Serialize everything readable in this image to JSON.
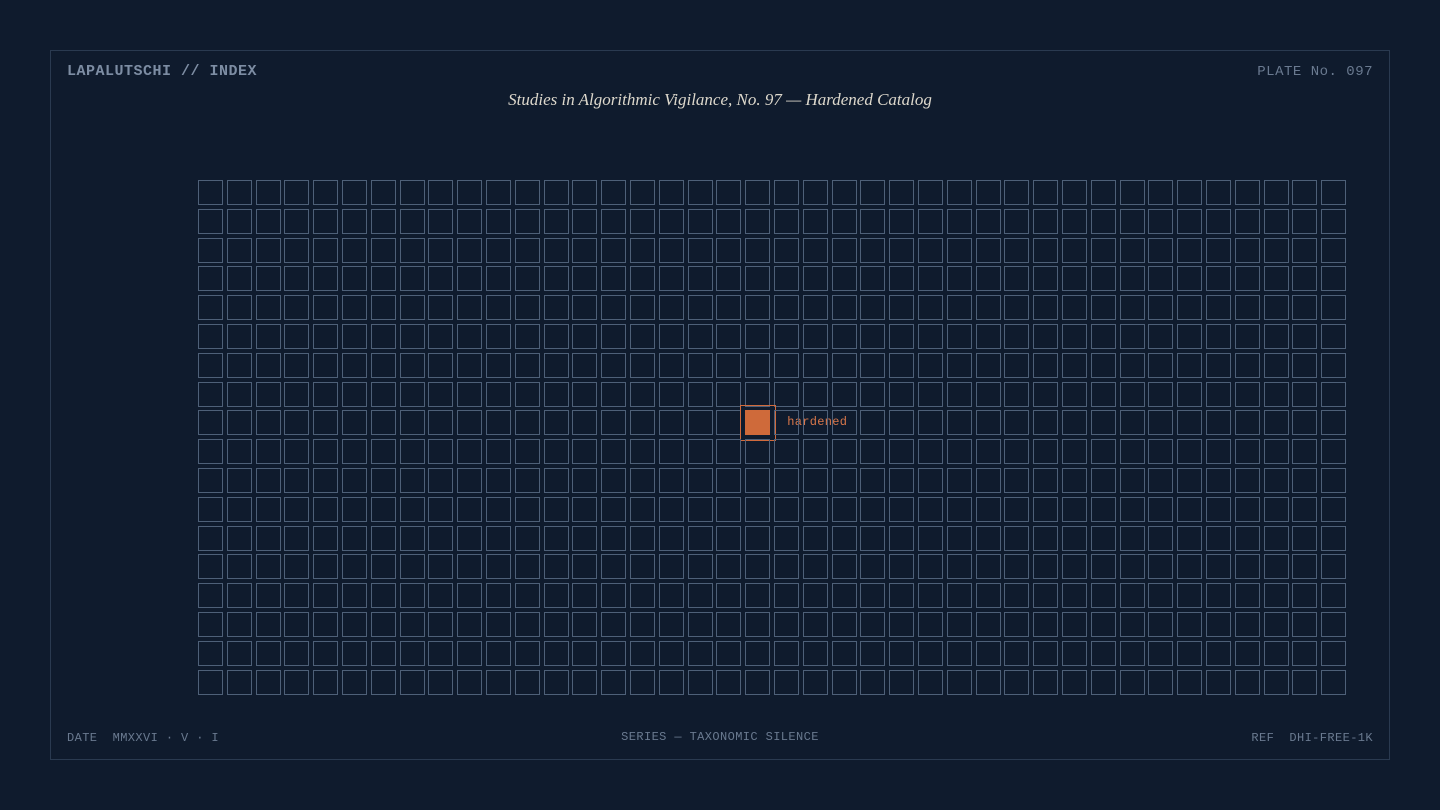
{
  "header": {
    "brand": "LAPALUTSCHI // INDEX",
    "plate_no": "PLATE No. 097"
  },
  "title": "Studies in Algorithmic Vigilance, No. 97 — Hardened Catalog",
  "grid": {
    "columns": 40,
    "rows": 18,
    "highlight": {
      "row": 8,
      "col": 19,
      "label": "hardened"
    }
  },
  "footer": {
    "date": "DATE  MMXXVI · V · I",
    "series": "SERIES — TAXONOMIC SILENCE",
    "ref": "REF  DHI-FREE-1K"
  },
  "colors": {
    "background": "#0f1b2d",
    "cell_stroke": "#4e6078",
    "accent": "#cf6a3a"
  }
}
